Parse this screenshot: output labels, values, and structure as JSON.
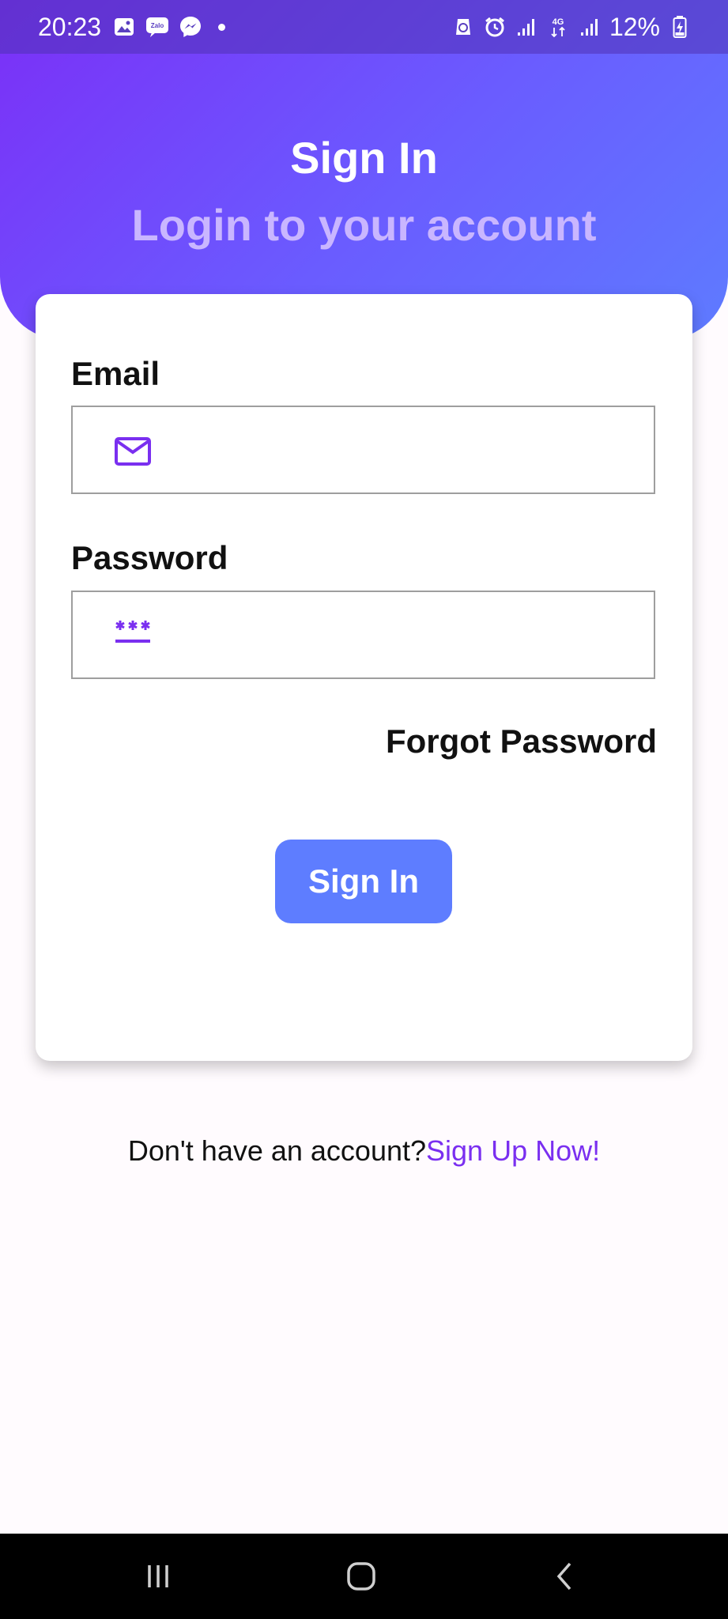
{
  "status_bar": {
    "time": "20:23",
    "battery": "12%",
    "left_icons": [
      "gallery-icon",
      "zalo-icon",
      "messenger-icon",
      "notification-dot"
    ],
    "right_icons": [
      "recycle-icon",
      "alarm-icon",
      "signal-icon",
      "4g-icon",
      "signal-icon",
      "battery-charging-icon"
    ]
  },
  "header": {
    "title": "Sign In",
    "subtitle": "Login to your account"
  },
  "form": {
    "email_label": "Email",
    "email_value": "",
    "email_icon": "mail-icon",
    "password_label": "Password",
    "password_value": "",
    "password_icon": "password-icon",
    "forgot_label": "Forgot Password",
    "submit_label": "Sign In"
  },
  "footer": {
    "prompt": "Don't have an account?",
    "link_label": "Sign Up Now!"
  },
  "nav_bar": {
    "buttons": [
      "recent-apps-icon",
      "home-icon",
      "back-icon"
    ]
  },
  "colors": {
    "gradient_start": "#7b2ff7",
    "gradient_end": "#5e7bff",
    "accent_purple": "#7a2ff0",
    "button_blue": "#5e7dff",
    "subtitle": "#c9b6ff"
  }
}
